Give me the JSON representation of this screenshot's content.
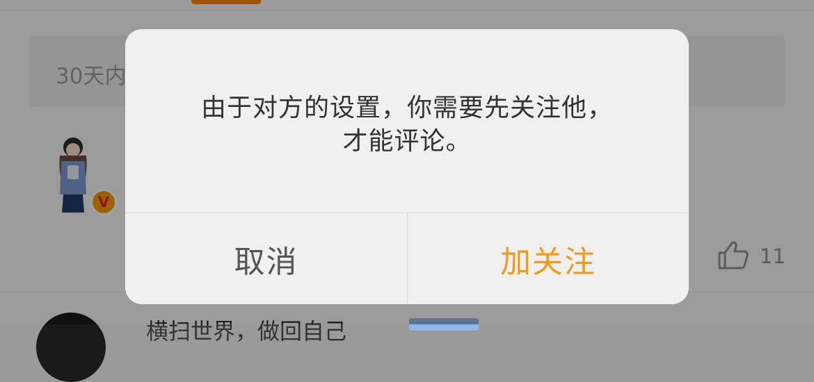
{
  "background": {
    "filter_text": "30天内",
    "like_count": "11",
    "next_comment_name": "横扫世界，做回自己"
  },
  "dialog": {
    "message": "由于对方的设置，你需要先关注他，\n才能评论。",
    "cancel_label": "取消",
    "confirm_label": "加关注"
  },
  "colors": {
    "accent": "#ff8200",
    "confirm": "#f39a1b",
    "badge": "#f19a00"
  },
  "icons": {
    "like": "thumb-up-icon",
    "badge": "verified-v-icon"
  }
}
